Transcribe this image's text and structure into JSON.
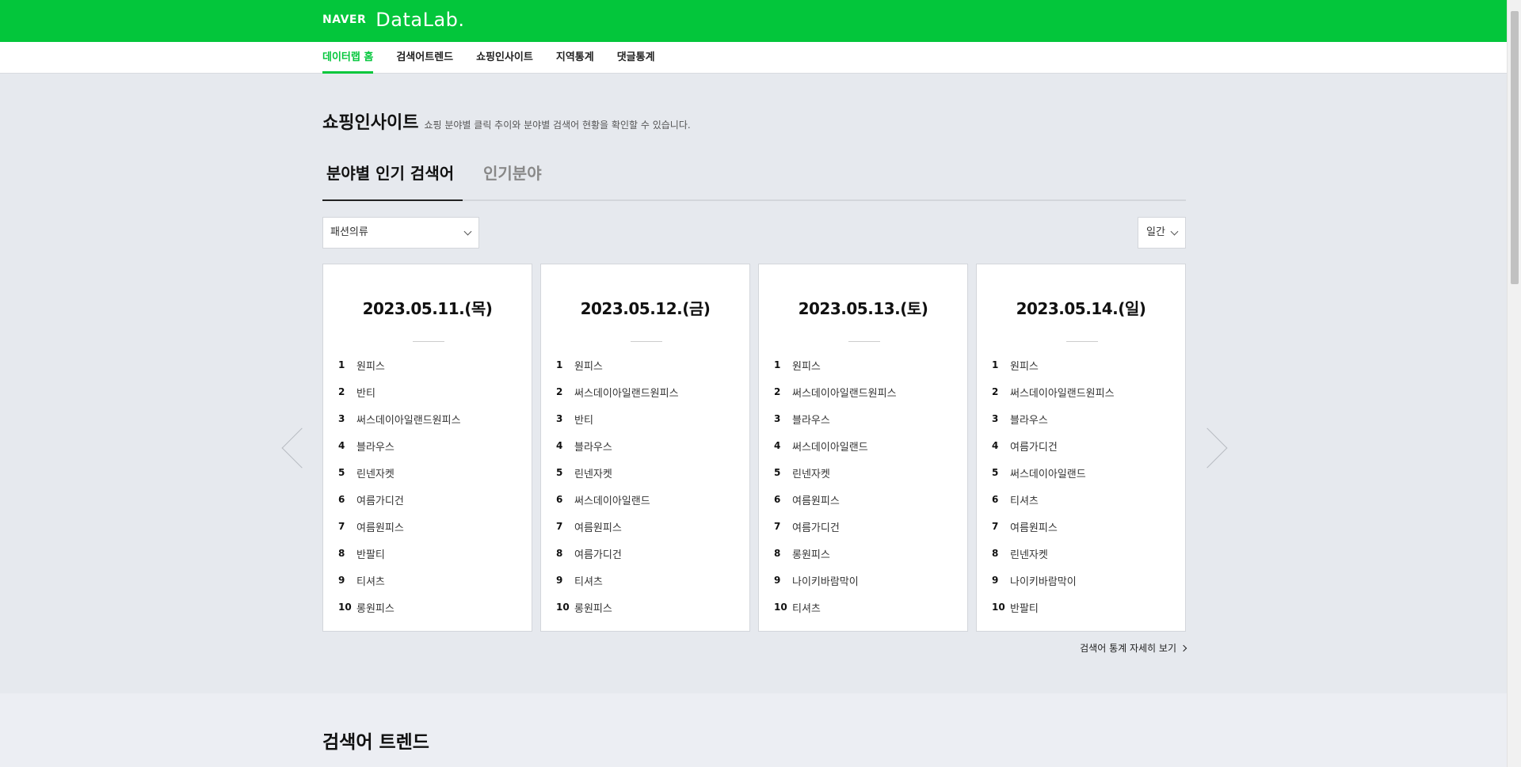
{
  "brand": {
    "naver": "NAVER",
    "datalab": "DataLab."
  },
  "nav": {
    "items": [
      {
        "label": "데이터랩 홈",
        "active": true
      },
      {
        "label": "검색어트렌드",
        "active": false
      },
      {
        "label": "쇼핑인사이트",
        "active": false
      },
      {
        "label": "지역통계",
        "active": false
      },
      {
        "label": "댓글통계",
        "active": false
      }
    ]
  },
  "page": {
    "title": "쇼핑인사이트",
    "description": "쇼핑 분야별 클릭 추이와 분야별 검색어 현황을 확인할 수 있습니다."
  },
  "tabs": [
    {
      "label": "분야별 인기 검색어",
      "active": true
    },
    {
      "label": "인기분야",
      "active": false
    }
  ],
  "filters": {
    "category": "패션의류",
    "period": "일간"
  },
  "cards": [
    {
      "date": "2023.05.11.(목)",
      "items": [
        "원피스",
        "반티",
        "써스데이아일랜드원피스",
        "블라우스",
        "린넨자켓",
        "여름가디건",
        "여름원피스",
        "반팔티",
        "티셔츠",
        "롱원피스"
      ]
    },
    {
      "date": "2023.05.12.(금)",
      "items": [
        "원피스",
        "써스데이아일랜드원피스",
        "반티",
        "블라우스",
        "린넨자켓",
        "써스데이아일랜드",
        "여름원피스",
        "여름가디건",
        "티셔츠",
        "롱원피스"
      ]
    },
    {
      "date": "2023.05.13.(토)",
      "items": [
        "원피스",
        "써스데이아일랜드원피스",
        "블라우스",
        "써스데이아일랜드",
        "린넨자켓",
        "여름원피스",
        "여름가디건",
        "롱원피스",
        "나이키바람막이",
        "티셔츠"
      ]
    },
    {
      "date": "2023.05.14.(일)",
      "items": [
        "원피스",
        "써스데이아일랜드원피스",
        "블라우스",
        "여름가디건",
        "써스데이아일랜드",
        "티셔츠",
        "여름원피스",
        "린넨자켓",
        "나이키바람막이",
        "반팔티"
      ]
    }
  ],
  "more_link": "검색어 통계 자세히 보기",
  "section2": {
    "title": "검색어 트렌드"
  },
  "colors": {
    "brand_green": "#03c63b",
    "background": "#e6e9ee"
  }
}
